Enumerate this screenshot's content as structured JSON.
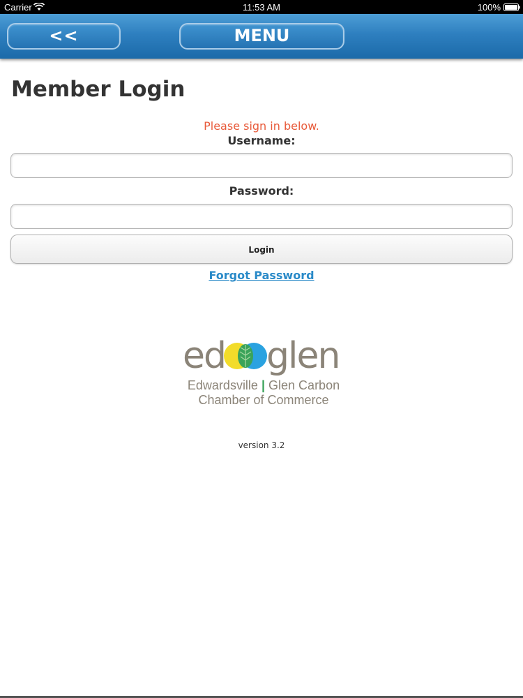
{
  "status_bar": {
    "carrier": "Carrier",
    "time": "11:53 AM",
    "battery": "100%",
    "wifi_icon": "wifi-icon",
    "battery_icon": "battery-icon"
  },
  "header": {
    "back_label": "<<",
    "menu_label": "MENU",
    "color": "#2e7fbf"
  },
  "login": {
    "title": "Member Login",
    "prompt": "Please sign in below.",
    "prompt_color": "#e85a3a",
    "username_label": "Username:",
    "username_value": "",
    "password_label": "Password:",
    "password_value": "",
    "login_button": "Login",
    "forgot_link": "Forgot Password",
    "link_color": "#2a8ac8"
  },
  "logo": {
    "word_left": "ed",
    "word_right": "glen",
    "tagline_left": "Edwardsville",
    "tagline_sep": "|",
    "tagline_right": "Glen Carbon",
    "tagline_line2": "Chamber of Commerce",
    "colors": {
      "gray": "#8b8478",
      "green": "#3aa35a",
      "yellow": "#f2dc2a",
      "blue": "#2aa2e0"
    }
  },
  "footer": {
    "version": "version 3.2"
  }
}
